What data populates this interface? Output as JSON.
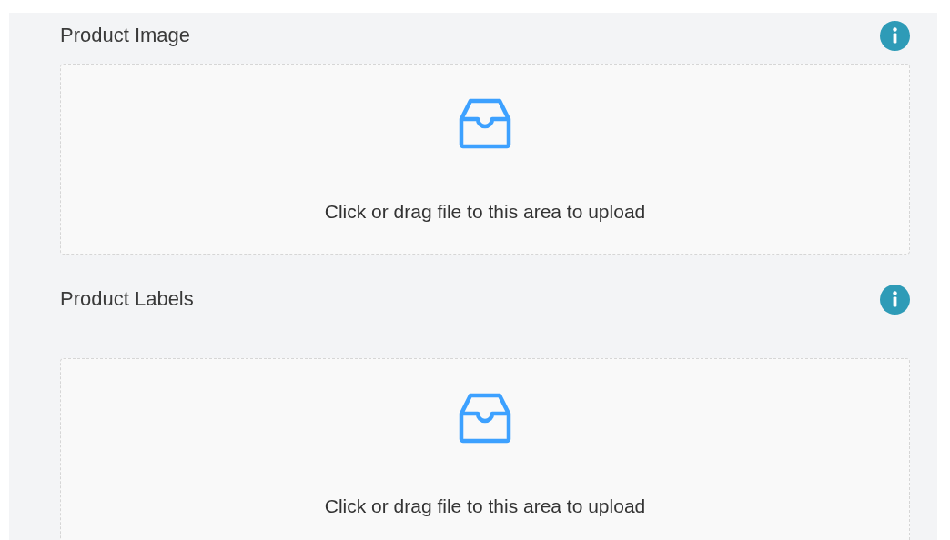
{
  "sections": [
    {
      "label": "Product Image",
      "upload": {
        "text": "Click or drag file to this area to upload"
      }
    },
    {
      "label": "Product Labels",
      "upload": {
        "text": "Click or drag file to this area to upload"
      }
    }
  ]
}
